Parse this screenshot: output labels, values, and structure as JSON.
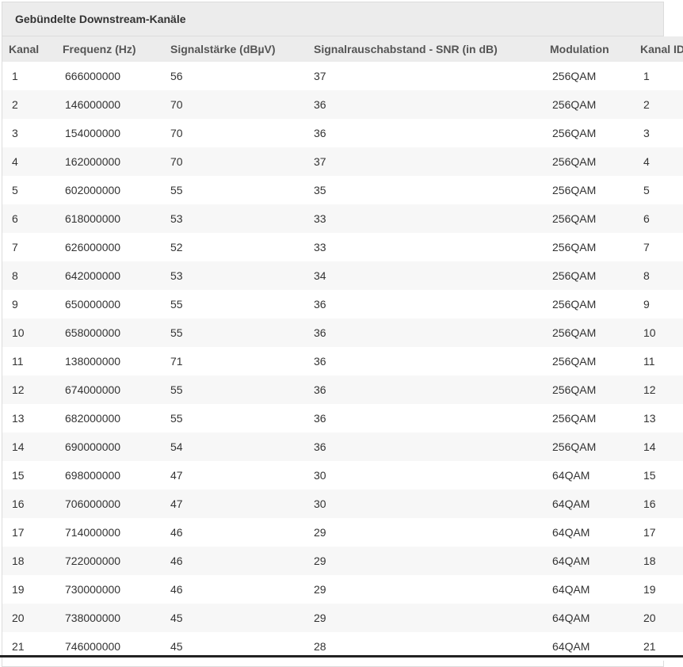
{
  "panel": {
    "title": "Gebündelte Downstream-Kanäle"
  },
  "table": {
    "headers": [
      "Kanal",
      "Frequenz (Hz)",
      "Signalstärke (dBµV)",
      "Signalrauschabstand - SNR (in dB)",
      "Modulation",
      "Kanal ID"
    ],
    "rows": [
      [
        "1",
        "666000000",
        "56",
        "37",
        "256QAM",
        "1"
      ],
      [
        "2",
        "146000000",
        "70",
        "36",
        "256QAM",
        "2"
      ],
      [
        "3",
        "154000000",
        "70",
        "36",
        "256QAM",
        "3"
      ],
      [
        "4",
        "162000000",
        "70",
        "37",
        "256QAM",
        "4"
      ],
      [
        "5",
        "602000000",
        "55",
        "35",
        "256QAM",
        "5"
      ],
      [
        "6",
        "618000000",
        "53",
        "33",
        "256QAM",
        "6"
      ],
      [
        "7",
        "626000000",
        "52",
        "33",
        "256QAM",
        "7"
      ],
      [
        "8",
        "642000000",
        "53",
        "34",
        "256QAM",
        "8"
      ],
      [
        "9",
        "650000000",
        "55",
        "36",
        "256QAM",
        "9"
      ],
      [
        "10",
        "658000000",
        "55",
        "36",
        "256QAM",
        "10"
      ],
      [
        "11",
        "138000000",
        "71",
        "36",
        "256QAM",
        "11"
      ],
      [
        "12",
        "674000000",
        "55",
        "36",
        "256QAM",
        "12"
      ],
      [
        "13",
        "682000000",
        "55",
        "36",
        "256QAM",
        "13"
      ],
      [
        "14",
        "690000000",
        "54",
        "36",
        "256QAM",
        "14"
      ],
      [
        "15",
        "698000000",
        "47",
        "30",
        "64QAM",
        "15"
      ],
      [
        "16",
        "706000000",
        "47",
        "30",
        "64QAM",
        "16"
      ],
      [
        "17",
        "714000000",
        "46",
        "29",
        "64QAM",
        "17"
      ],
      [
        "18",
        "722000000",
        "46",
        "29",
        "64QAM",
        "18"
      ],
      [
        "19",
        "730000000",
        "46",
        "29",
        "64QAM",
        "19"
      ],
      [
        "20",
        "738000000",
        "45",
        "29",
        "64QAM",
        "20"
      ],
      [
        "21",
        "746000000",
        "45",
        "28",
        "64QAM",
        "21"
      ]
    ]
  }
}
